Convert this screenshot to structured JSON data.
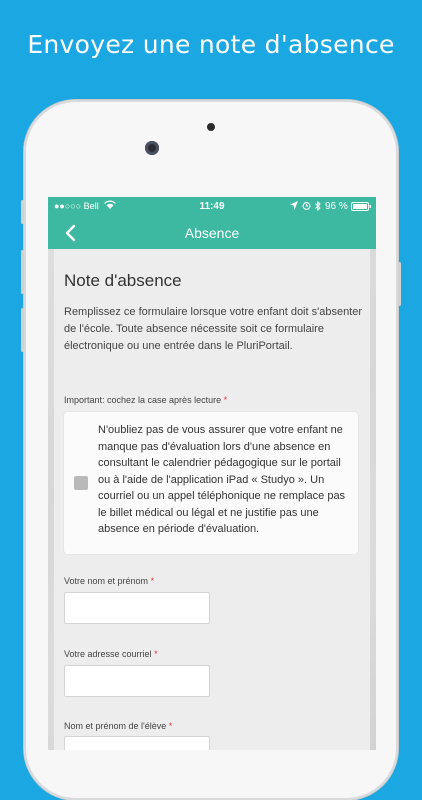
{
  "headline": "Envoyez une note d'absence",
  "status_bar": {
    "carrier": "●●○○○ Bell",
    "time": "11:49",
    "battery_text": "96 %"
  },
  "nav": {
    "title": "Absence",
    "back_icon": "chevron-left-icon"
  },
  "form": {
    "title": "Note d'absence",
    "intro": "Remplissez ce formulaire lorsque votre enfant doit s'absenter de l'école. Toute absence nécessite soit ce formulaire électronique ou une entrée dans le PluriPortail.",
    "important_label": "Important: cochez la case après lecture",
    "required_mark": "*",
    "notice_text": "N'oubliez pas de vous assurer que votre enfant ne manque pas d'évaluation lors d'une absence en consultant le calendrier pédagogique sur le portail ou à l'aide de l'application iPad « Studyo ». Un courriel ou un appel téléphonique ne remplace pas le billet médical ou légal et ne justifie pas une absence en période d'évaluation.",
    "name_label": "Votre nom et prénom",
    "name_value": "",
    "email_label": "Votre adresse courriel",
    "email_value": "",
    "student_label": "Nom et prénom de l'élève",
    "student_value": ""
  },
  "colors": {
    "background": "#1ba7e1",
    "nav_accent": "#3cb9a0",
    "required": "#e03a3a"
  }
}
